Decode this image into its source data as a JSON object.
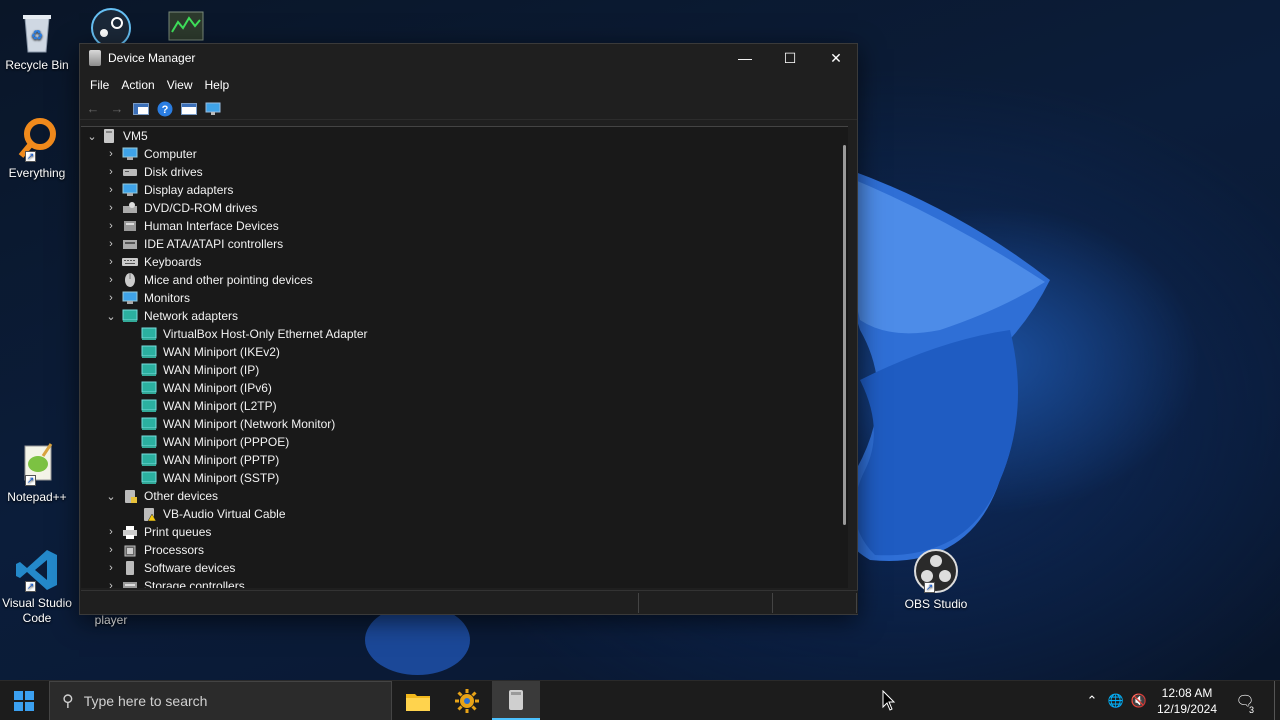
{
  "desktop": {
    "icons": {
      "recycle_bin": "Recycle Bin",
      "everything": "Everything",
      "notepadpp": "Notepad++",
      "vscode_line1": "Visual Studio",
      "vscode_line2": "Code",
      "player": "player",
      "obs": "OBS Studio"
    }
  },
  "window": {
    "title": "Device Manager",
    "controls": {
      "minimize": "—",
      "maximize": "☐",
      "close": "✕"
    },
    "menu": [
      "File",
      "Action",
      "View",
      "Help"
    ],
    "tree": {
      "root": "VM5",
      "categories": [
        "Computer",
        "Disk drives",
        "Display adapters",
        "DVD/CD-ROM drives",
        "Human Interface Devices",
        "IDE ATA/ATAPI controllers",
        "Keyboards",
        "Mice and other pointing devices",
        "Monitors",
        "Network adapters"
      ],
      "network_adapters": [
        "VirtualBox Host-Only Ethernet Adapter",
        "WAN Miniport (IKEv2)",
        "WAN Miniport (IP)",
        "WAN Miniport (IPv6)",
        "WAN Miniport (L2TP)",
        "WAN Miniport (Network Monitor)",
        "WAN Miniport (PPPOE)",
        "WAN Miniport (PPTP)",
        "WAN Miniport (SSTP)"
      ],
      "other_devices": "Other devices",
      "other_devices_children": [
        "VB-Audio Virtual Cable"
      ],
      "categories_after": [
        "Print queues",
        "Processors",
        "Software devices",
        "Storage controllers"
      ]
    }
  },
  "taskbar": {
    "search_placeholder": "Type here to search",
    "time": "12:08 AM",
    "date": "12/19/2024",
    "notification_count": "3"
  }
}
